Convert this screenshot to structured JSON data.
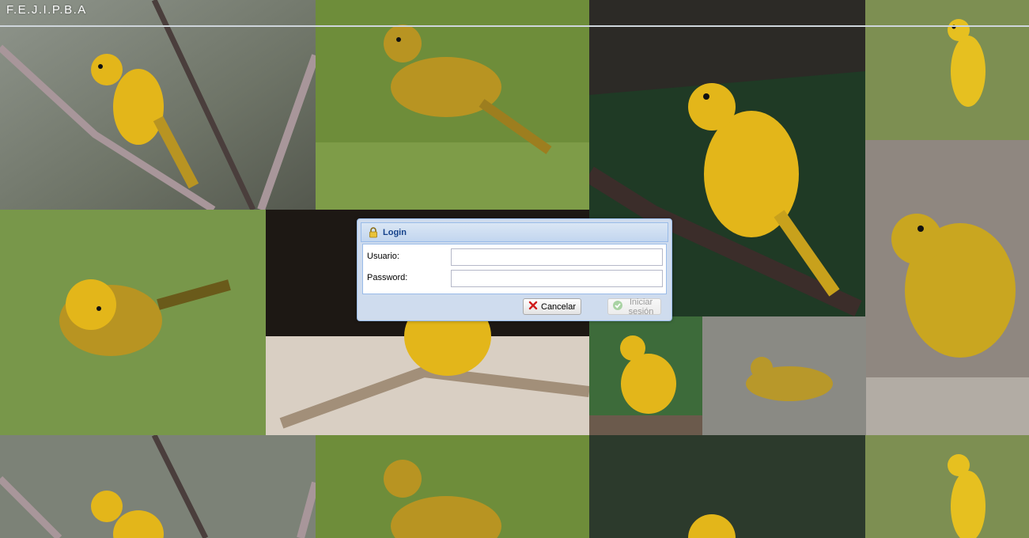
{
  "app": {
    "brand": "F.E.J.I.P.B.A"
  },
  "background": {
    "subject": "yellow finch photo collage",
    "colors": {
      "branch": "#a8969a",
      "grass": "#6e8d3a",
      "bird_yellow": "#e3b61a",
      "bird_olive": "#b89422",
      "dark_green": "#1f3a25",
      "gravel": "#8a8a84",
      "stone": "#b2aca4"
    }
  },
  "login": {
    "title": "Login",
    "icon": "lock-icon",
    "fields": {
      "username": {
        "label": "Usuario:",
        "value": "",
        "placeholder": ""
      },
      "password": {
        "label": "Password:",
        "value": "",
        "placeholder": ""
      }
    },
    "buttons": {
      "cancel": {
        "label": "Cancelar",
        "icon": "red-x-icon"
      },
      "submit": {
        "label": "Iniciar sesión",
        "icon": "check-icon",
        "enabled": false
      }
    }
  }
}
